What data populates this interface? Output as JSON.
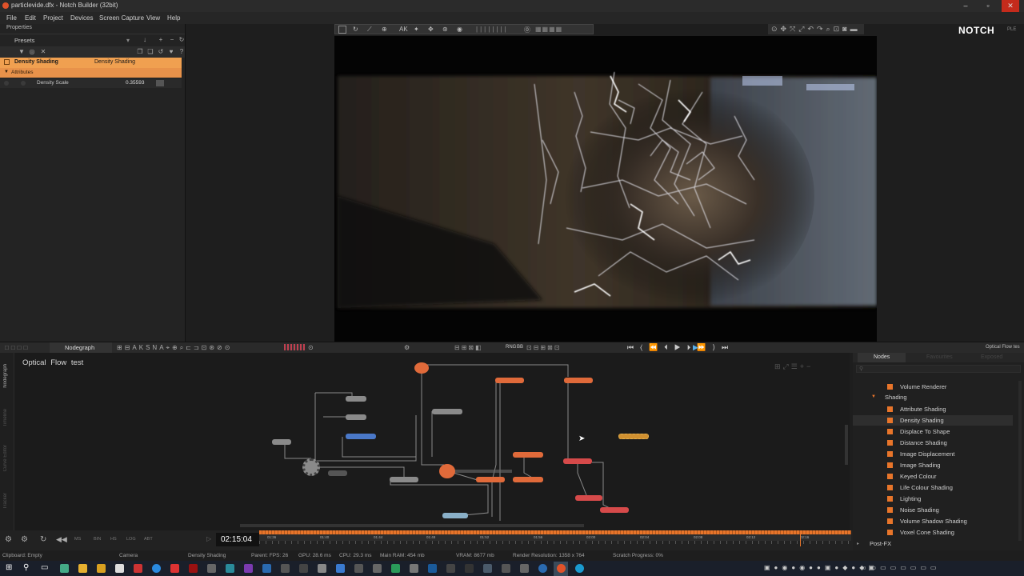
{
  "window": {
    "title": "particlevide.dfx - Notch Builder (32bit)"
  },
  "menu": [
    "File",
    "Edit",
    "Project",
    "Devices",
    "Screen Capture",
    "View",
    "Help"
  ],
  "brand": {
    "logo": "NOTCH",
    "edition": "PLE"
  },
  "properties": {
    "tab": "Properties",
    "presets_label": "Presets",
    "selected_node": "Density Shading",
    "selected_type": "Density Shading",
    "section": "Attributes",
    "params": [
      {
        "name": "Density Scale",
        "value": "0.35593"
      }
    ]
  },
  "nodegraph": {
    "tab_label": "Nodegraph",
    "title": "Optical Flow test",
    "side_tabs": [
      "Nodegraph",
      "Timeline",
      "Curve Editor",
      "Tracker"
    ],
    "bottom_toolbar_labels": [
      "RNG",
      "BB"
    ],
    "right_tab": "Optical Flow tes"
  },
  "nodes_panel": {
    "tabs": [
      "Nodes",
      "Favourites",
      "Exposed"
    ],
    "items_top": [
      "Volume Renderer"
    ],
    "group": "Shading",
    "items": [
      "Attribute Shading",
      "Density Shading",
      "Displace To Shape",
      "Distance Shading",
      "Image Displacement",
      "Image Shading",
      "Keyed Colour",
      "Life Colour Shading",
      "Lighting",
      "Noise Shading",
      "Volume Shadow Shading",
      "Voxel Cone Shading"
    ],
    "selected": "Density Shading",
    "next_group": "Post-FX"
  },
  "timeline": {
    "timecode": "02:15:04",
    "buttons": [
      "MS",
      "BIN",
      "HS",
      "LOG",
      "ABT"
    ],
    "ticks": [
      "01:36",
      "01:40",
      "01:44",
      "01:48",
      "01:52",
      "01:56",
      "02:00",
      "02:04",
      "02:08",
      "02:12",
      "02:16"
    ]
  },
  "status": {
    "clipboard": "Clipboard: Empty",
    "camera": "Camera",
    "node": "Density Shading",
    "fps": "Parent: FPS: 26",
    "gpu": "GPU: 28.6 ms",
    "cpu": "CPU: 29.3 ms",
    "ram": "Main RAM: 454 mb",
    "vram": "VRAM: 8677 mb",
    "resolution": "Render Resolution: 1358 x 764",
    "scratch": "Scratch Progress: 0%"
  },
  "colors": {
    "accent": "#e8752a",
    "selection": "#f0a050",
    "background": "#1e1e1e",
    "node_orange": "#e06a3a",
    "node_gray": "#8a8a8a",
    "node_blue": "#4a78c8"
  }
}
